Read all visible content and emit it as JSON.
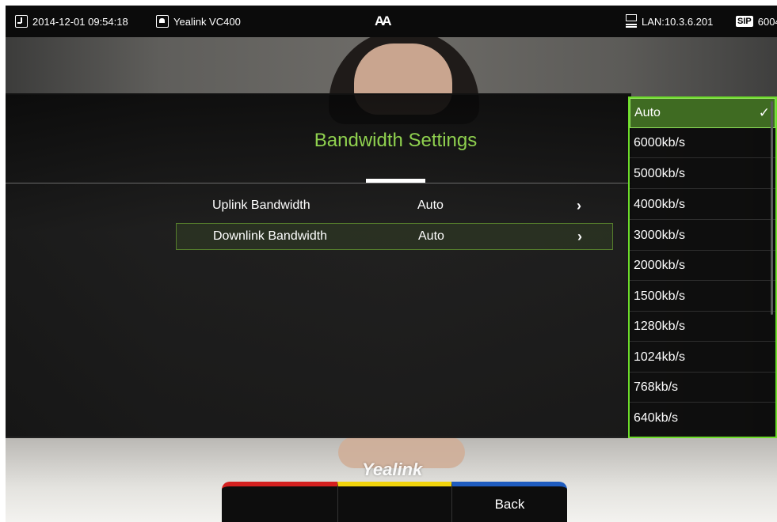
{
  "status_bar": {
    "datetime": "2014-12-01 09:54:18",
    "device_name": "Yealink VC400",
    "font_icon_text": "AA",
    "lan": "LAN:10.3.6.201",
    "sip_badge": "SIP",
    "sip_account": "6004"
  },
  "panel": {
    "title": "Bandwidth Settings",
    "rows": [
      {
        "label": "Uplink Bandwidth",
        "value": "Auto",
        "arrow": "›"
      },
      {
        "label": "Downlink Bandwidth",
        "value": "Auto",
        "arrow": "›"
      }
    ]
  },
  "dropdown": {
    "selected_index": 0,
    "check_mark": "✓",
    "options": [
      "Auto",
      "6000kb/s",
      "5000kb/s",
      "4000kb/s",
      "3000kb/s",
      "2000kb/s",
      "1500kb/s",
      "1280kb/s",
      "1024kb/s",
      "768kb/s",
      "640kb/s"
    ]
  },
  "logo": "Yealink",
  "softkeys": {
    "red": "",
    "yellow": "",
    "blue": "Back"
  },
  "colors": {
    "title_green": "#8fd14f",
    "dropdown_border": "#6ddc2a",
    "selected_bg": "#3f6b22",
    "softkey_red": "#d4201f",
    "softkey_yellow": "#f1d40c",
    "softkey_blue": "#1f5cbf"
  }
}
